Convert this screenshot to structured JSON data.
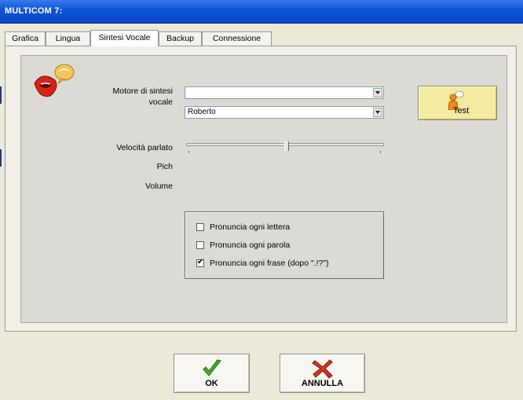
{
  "window": {
    "title": "MULTICOM 7:"
  },
  "tabs": [
    {
      "label": "Grafica",
      "active": false
    },
    {
      "label": "Lingua",
      "active": false
    },
    {
      "label": "Sintesi Vocale",
      "active": true
    },
    {
      "label": "Backup",
      "active": false
    },
    {
      "label": "Connessione",
      "active": false
    }
  ],
  "tts": {
    "engine_label_line1": "Motore di sintesi",
    "engine_label_line2": "vocale",
    "engine_value": "",
    "voice_value": "Roberto",
    "speed_label": "Velocità parlato",
    "speed_level_percent": 50,
    "pitch_label": "Pich",
    "volume_label": "Volume",
    "test_label": "Test"
  },
  "options": [
    {
      "label": "Pronuncia ogni lettera",
      "checked": false
    },
    {
      "label": "Pronuncia ogni parola",
      "checked": false
    },
    {
      "label": "Pronuncia ogni frase (dopo \".!?\")",
      "checked": true
    }
  ],
  "buttons": {
    "ok_label": "OK",
    "cancel_label": "ANNULLA"
  },
  "colors": {
    "title_bar": "#0f56d8",
    "test_button": "#f3eba0",
    "ok_check": "#3fae2a",
    "cancel_x": "#d9361e"
  },
  "icons": {
    "speaker": "lips-speech-bubble-icon",
    "test": "person-speaking-icon",
    "ok": "green-check-icon",
    "cancel": "red-x-icon"
  }
}
